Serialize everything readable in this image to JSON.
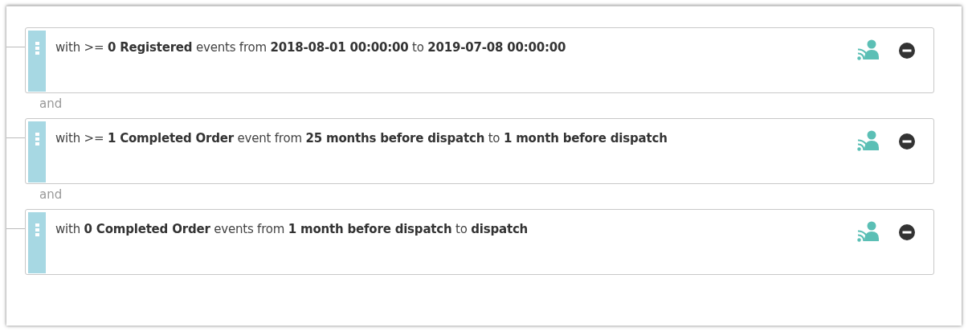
{
  "conditions": [
    {
      "text": "with >= **0 Registered** events from **2018-08-01 00:00:00** to **2019-07-08 00:00:00**"
    },
    {
      "text": "with >= **1 Completed Order** event from **25 months before dispatch** to **1 month before dispatch**"
    },
    {
      "text": "with **0 Completed Order** events from **1 month before dispatch** to **dispatch**"
    }
  ],
  "joiners": [
    "and",
    "and"
  ]
}
